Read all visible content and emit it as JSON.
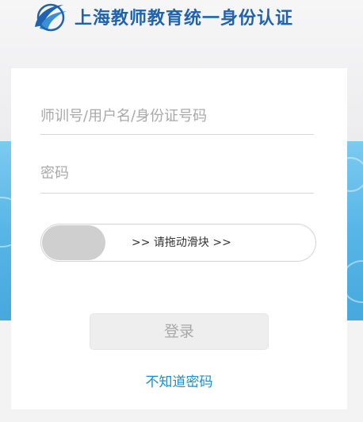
{
  "header": {
    "logo_icon": "bird-swoosh-logo",
    "title": "上海教师教育统一身份认证"
  },
  "form": {
    "username_placeholder": "师训号/用户名/身份证号码",
    "password_placeholder": "密码",
    "slider_label": ">> 请拖动滑块 >>",
    "login_label": "登录",
    "forgot_label": "不知道密码"
  },
  "colors": {
    "title_blue": "#1f63b0",
    "band_blue": "#57b6e6",
    "link_blue": "#1a8fd2"
  }
}
